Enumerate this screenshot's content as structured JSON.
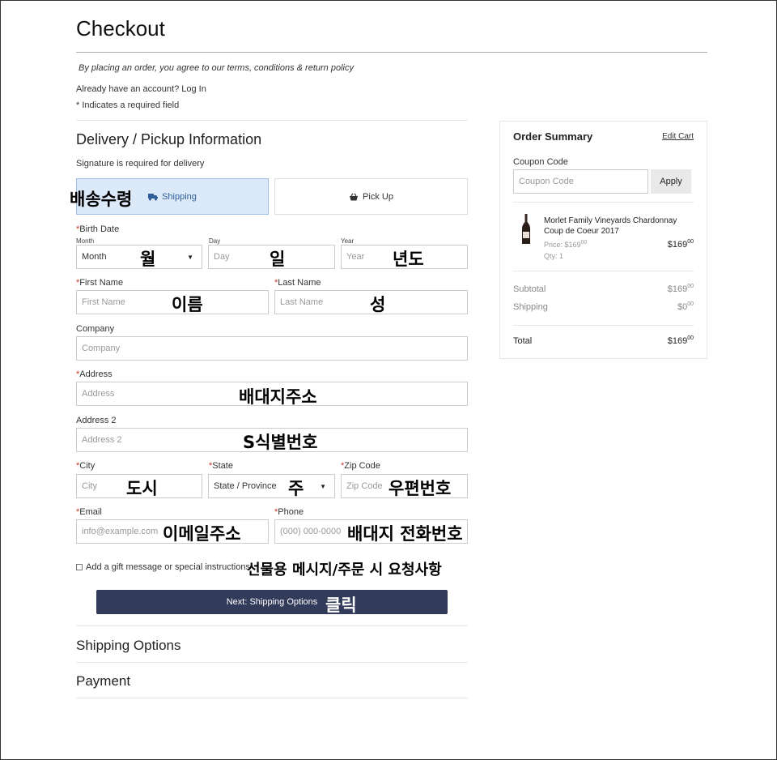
{
  "page": {
    "title": "Checkout",
    "terms": "By placing an order, you agree to our terms, conditions & return policy",
    "account_prompt": "Already have an account?",
    "login_link": "Log In",
    "required_note": "* Indicates a required field"
  },
  "delivery": {
    "title": "Delivery / Pickup Information",
    "signature_note": "Signature is required for delivery",
    "method_shipping": "Shipping",
    "method_pickup": "Pick Up",
    "selected_method": "Shipping"
  },
  "form": {
    "birth_date_label": "Birth Date",
    "month_label": "Month",
    "month_value": "Month",
    "day_label": "Day",
    "day_placeholder": "Day",
    "year_label": "Year",
    "year_placeholder": "Year",
    "first_name_label": "First Name",
    "first_name_placeholder": "First Name",
    "last_name_label": "Last Name",
    "last_name_placeholder": "Last Name",
    "company_label": "Company",
    "company_placeholder": "Company",
    "address_label": "Address",
    "address_placeholder": "Address",
    "address2_label": "Address 2",
    "address2_placeholder": "Address 2",
    "city_label": "City",
    "city_placeholder": "City",
    "state_label": "State",
    "state_value": "State / Province",
    "zip_label": "Zip Code",
    "zip_placeholder": "Zip Code",
    "email_label": "Email",
    "email_placeholder": "info@example.com",
    "phone_label": "Phone",
    "phone_placeholder": "(000) 000-0000",
    "gift_label": "Add a gift message or special instructions",
    "required_mark": "*",
    "next_button": "Next: Shipping Options"
  },
  "annotations": {
    "shipping": "배송수령",
    "month": "월",
    "day": "일",
    "year": "년도",
    "first_name": "이름",
    "last_name": "성",
    "address": "배대지주소",
    "address2": "S식별번호",
    "city": "도시",
    "state": "주",
    "zip": "우편번호",
    "email": "이메일주소",
    "phone": "배대지 전화번호",
    "gift": "선물용 메시지/주문 시 요청사항",
    "next": "클릭"
  },
  "sections": {
    "shipping_options": "Shipping Options",
    "payment": "Payment"
  },
  "summary": {
    "title": "Order Summary",
    "edit_cart": "Edit Cart",
    "coupon_label": "Coupon Code",
    "coupon_placeholder": "Coupon Code",
    "apply": "Apply",
    "product_name": "Morlet Family Vineyards Chardonnay Coup de Coeur 2017",
    "price_label": "Price: $169",
    "price_cents": "00",
    "qty": "Qty: 1",
    "line_total": "$169",
    "line_total_cents": "00",
    "subtotal_label": "Subtotal",
    "subtotal": "$169",
    "subtotal_cents": "00",
    "shipping_label": "Shipping",
    "shipping": "$0",
    "shipping_cents": "00",
    "total_label": "Total",
    "total": "$169",
    "total_cents": "00"
  },
  "colors": {
    "accent_button": "#323b59",
    "active_method_bg": "#dce9f9",
    "active_method_text": "#2f5f9a",
    "required_mark": "#c0392b"
  },
  "icons": {
    "shipping": "truck-icon",
    "pickup": "basket-icon",
    "product": "wine-bottle-icon",
    "select_caret": "caret-down-icon"
  }
}
